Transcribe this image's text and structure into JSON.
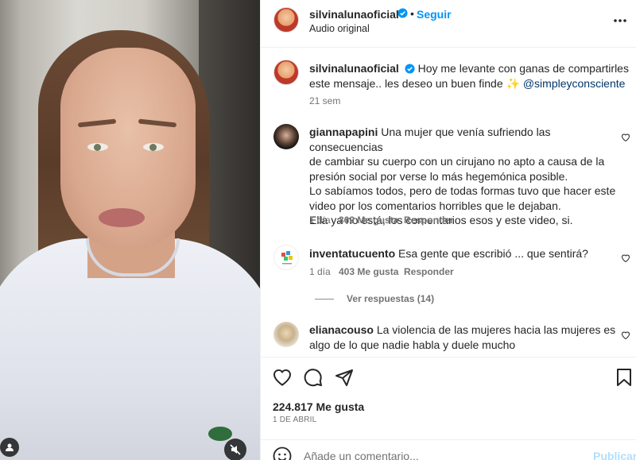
{
  "post": {
    "author": "silvinalunaoficial",
    "follow_label": "Seguir",
    "audio": "Audio original",
    "caption_line1": "Hoy me levante con ganas de compartirles",
    "caption_line2_prefix": "este mensaje.. les deseo un buen finde ✨",
    "caption_mention": "@simpleyconsciente",
    "caption_time": "21 sem"
  },
  "comments": [
    {
      "user": "giannapapini",
      "lines": [
        "Una mujer que venía sufriendo las consecuencias",
        "de cambiar su cuerpo con un cirujano no apto a causa de la",
        "presión social por verse lo más hegemónica posible.",
        "Lo sabíamos todos, pero de todas formas tuvo que hacer este",
        "video por los comentarios horribles que le dejaban.",
        "Ella ya no está, los comentarios esos y este video, si."
      ],
      "time": "1 día",
      "likes": "362 Me gusta",
      "reply": "Responder"
    },
    {
      "user": "inventatucuento",
      "lines": [
        "Esa gente que escribió ... que sentirá?"
      ],
      "time": "1 día",
      "likes": "403 Me gusta",
      "reply": "Responder",
      "view_replies": "Ver respuestas (14)"
    },
    {
      "user": "elianacouso",
      "lines": [
        "La violencia de las mujeres hacia las mujeres es",
        "algo de lo que nadie habla y duele mucho"
      ]
    }
  ],
  "footer": {
    "likes": "224.817 Me gusta",
    "date": "1 DE ABRIL",
    "comment_placeholder": "Añade un comentario...",
    "publish": "Publicar"
  },
  "colors": {
    "link": "#0095f6",
    "mention": "#00376b",
    "muted": "#737373"
  },
  "icons": [
    "more-icon",
    "verified-icon",
    "heart-icon",
    "comment-icon",
    "share-icon",
    "save-icon",
    "emoji-icon",
    "mute-icon",
    "user-icon"
  ]
}
